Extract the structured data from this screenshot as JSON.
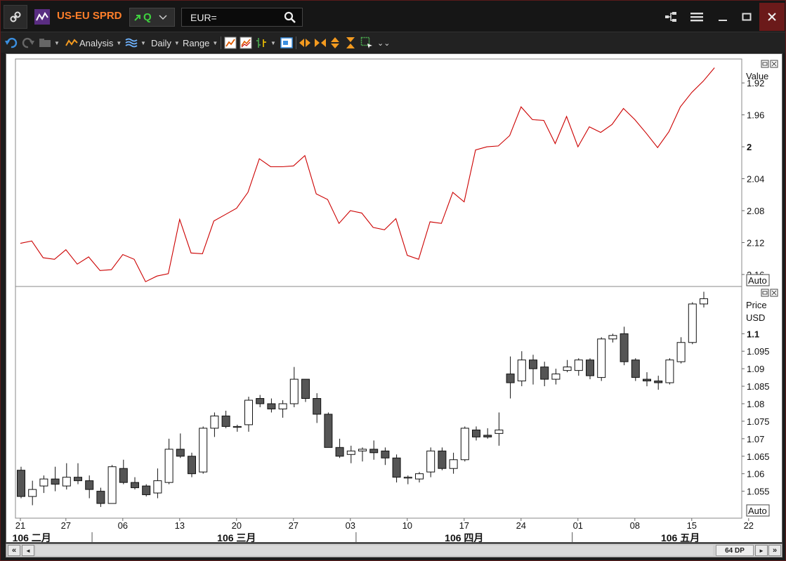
{
  "titlebar": {
    "title": "US-EU SPRD",
    "quote_label": "Q",
    "search_value": "EUR="
  },
  "toolbar": {
    "analysis_label": "Analysis",
    "interval_label": "Daily",
    "range_label": "Range"
  },
  "upper_panel": {
    "label": "Value",
    "auto_label": "Auto"
  },
  "lower_panel": {
    "label": "Price",
    "currency": "USD",
    "auto_label": "Auto"
  },
  "scrollbar": {
    "zoom_readout": "64 DP",
    "left_btn": "«",
    "right_btn": "»",
    "left_arrow": "◄",
    "right_arrow": "►"
  },
  "colors": {
    "line": "#cc0000",
    "candle_down": "#555555",
    "candle_up": "#ffffff",
    "accent_title": "#ff7f2a"
  },
  "chart_data": [
    {
      "type": "line",
      "series": [
        {
          "values": [
            2.121,
            2.118,
            2.139,
            2.141,
            2.129,
            2.147,
            2.138,
            2.155,
            2.154,
            2.135,
            2.141,
            2.169,
            2.162,
            2.159,
            2.091,
            2.133,
            2.134,
            2.093,
            2.085,
            2.077,
            2.057,
            2.015,
            2.025,
            2.025,
            2.024,
            2.011,
            2.059,
            2.066,
            2.096,
            2.08,
            2.083,
            2.101,
            2.104,
            2.09,
            2.136,
            2.141,
            2.094,
            2.096,
            2.057,
            2.069,
            2.004,
            2.0,
            1.999,
            1.986,
            1.95,
            1.966,
            1.967,
            1.996,
            1.962,
            2.0,
            1.975,
            1.982,
            1.972,
            1.952,
            1.966,
            1.983,
            2.001,
            1.981,
            1.95,
            1.932,
            1.918,
            1.901
          ]
        }
      ],
      "y_ticks": [
        1.92,
        1.96,
        2,
        2.04,
        2.08,
        2.12,
        2.16
      ],
      "ylim": [
        1.89,
        2.175
      ],
      "y_inverted": true
    },
    {
      "type": "candlestick",
      "series": [
        {
          "name": "Price",
          "ohlc": [
            [
              1.061,
              1.062,
              1.053,
              1.0535
            ],
            [
              1.0535,
              1.058,
              1.051,
              1.0555
            ],
            [
              1.0565,
              1.0595,
              1.0545,
              1.0585
            ],
            [
              1.0585,
              1.062,
              1.055,
              1.057
            ],
            [
              1.0565,
              1.063,
              1.0555,
              1.059
            ],
            [
              1.059,
              1.063,
              1.057,
              1.058
            ],
            [
              1.058,
              1.0595,
              1.053,
              1.0555
            ],
            [
              1.055,
              1.056,
              1.0505,
              1.0515
            ],
            [
              1.0515,
              1.0625,
              1.0515,
              1.062
            ],
            [
              1.0615,
              1.064,
              1.057,
              1.0575
            ],
            [
              1.0575,
              1.059,
              1.0555,
              1.056
            ],
            [
              1.0565,
              1.057,
              1.0535,
              1.054
            ],
            [
              1.0545,
              1.0615,
              1.053,
              1.058
            ],
            [
              1.0575,
              1.07,
              1.057,
              1.067
            ],
            [
              1.067,
              1.0715,
              1.0645,
              1.065
            ],
            [
              1.065,
              1.066,
              1.059,
              1.06
            ],
            [
              1.0605,
              1.0735,
              1.06,
              1.073
            ],
            [
              1.073,
              1.0775,
              1.0705,
              1.0765
            ],
            [
              1.0765,
              1.078,
              1.073,
              1.0735
            ],
            [
              1.0735,
              1.074,
              1.072,
              1.0735
            ],
            [
              1.074,
              1.082,
              1.072,
              1.081
            ],
            [
              1.0815,
              1.0825,
              1.079,
              1.08
            ],
            [
              1.08,
              1.0815,
              1.0775,
              1.0785
            ],
            [
              1.0785,
              1.081,
              1.076,
              1.08
            ],
            [
              1.08,
              1.0905,
              1.079,
              1.087
            ],
            [
              1.087,
              1.087,
              1.0805,
              1.0815
            ],
            [
              1.0815,
              1.083,
              1.0745,
              1.077
            ],
            [
              1.077,
              1.0775,
              1.0675,
              1.0675
            ],
            [
              1.0675,
              1.07,
              1.0645,
              1.065
            ],
            [
              1.0655,
              1.068,
              1.063,
              1.0665
            ],
            [
              1.0665,
              1.0675,
              1.0635,
              1.067
            ],
            [
              1.067,
              1.0695,
              1.064,
              1.066
            ],
            [
              1.0665,
              1.0675,
              1.0625,
              1.0645
            ],
            [
              1.0645,
              1.0655,
              1.0575,
              1.059
            ],
            [
              1.059,
              1.0595,
              1.057,
              1.059
            ],
            [
              1.0585,
              1.0605,
              1.0575,
              1.06
            ],
            [
              1.0605,
              1.0675,
              1.059,
              1.0665
            ],
            [
              1.0665,
              1.0675,
              1.061,
              1.0615
            ],
            [
              1.0615,
              1.066,
              1.06,
              1.064
            ],
            [
              1.064,
              1.0735,
              1.0635,
              1.073
            ],
            [
              1.0725,
              1.0735,
              1.0695,
              1.0705
            ],
            [
              1.071,
              1.073,
              1.07,
              1.0705
            ],
            [
              1.0715,
              1.0775,
              1.068,
              1.0725
            ],
            [
              1.0885,
              1.0935,
              1.0815,
              1.086
            ],
            [
              1.0865,
              1.095,
              1.085,
              1.0925
            ],
            [
              1.0925,
              1.094,
              1.0855,
              1.09
            ],
            [
              1.0905,
              1.092,
              1.085,
              1.087
            ],
            [
              1.087,
              1.09,
              1.0855,
              1.0885
            ],
            [
              1.0895,
              1.0925,
              1.089,
              1.0905
            ],
            [
              1.0895,
              1.093,
              1.088,
              1.0925
            ],
            [
              1.0925,
              1.093,
              1.087,
              1.088
            ],
            [
              1.0875,
              1.099,
              1.0865,
              1.0985
            ],
            [
              1.0985,
              1.1,
              1.0975,
              1.0995
            ],
            [
              1.1,
              1.102,
              1.091,
              1.092
            ],
            [
              1.0925,
              1.093,
              1.0865,
              1.0875
            ],
            [
              1.087,
              1.089,
              1.085,
              1.0865
            ],
            [
              1.0865,
              1.088,
              1.084,
              1.086
            ],
            [
              1.086,
              1.093,
              1.0855,
              1.0925
            ],
            [
              1.092,
              1.099,
              1.0915,
              1.0975
            ],
            [
              1.0975,
              1.109,
              1.097,
              1.1085
            ],
            [
              1.1085,
              1.112,
              1.1075,
              1.11
            ]
          ]
        }
      ],
      "y_ticks": [
        1.055,
        1.06,
        1.065,
        1.07,
        1.075,
        1.08,
        1.085,
        1.09,
        1.095,
        1.1
      ],
      "ylim": [
        1.0473,
        1.1135
      ],
      "x_ticks": [
        "21",
        "27",
        "06",
        "13",
        "20",
        "27",
        "03",
        "10",
        "17",
        "24",
        "01",
        "08",
        "15",
        "22"
      ],
      "month_labels": [
        "106 二月",
        "106 三月",
        "106 四月",
        "106 五月"
      ]
    }
  ]
}
